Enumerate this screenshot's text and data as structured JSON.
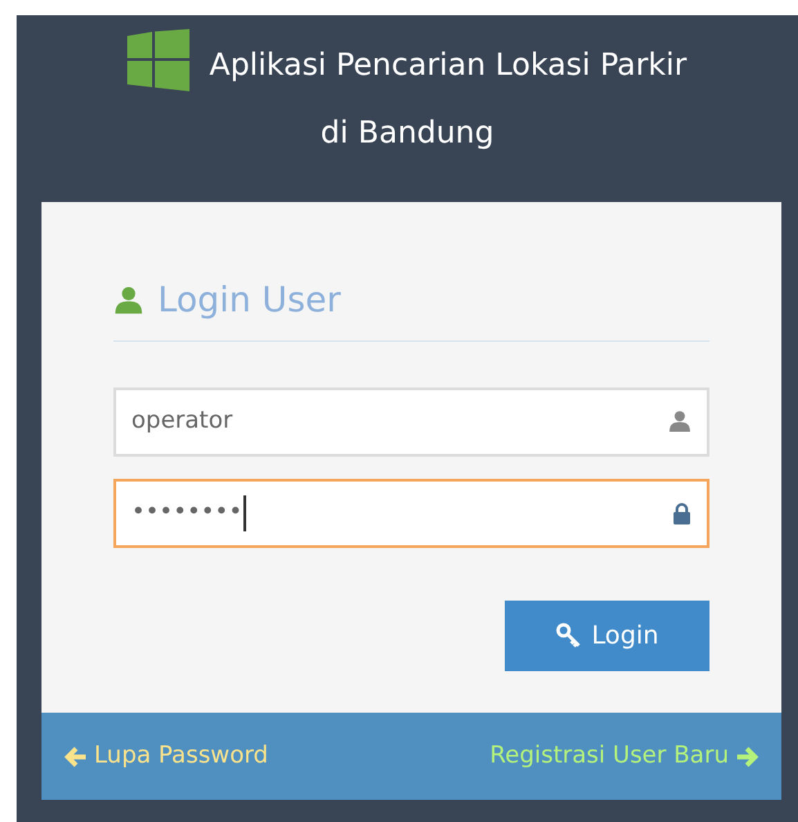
{
  "header": {
    "title_line_1": "Aplikasi Pencarian Lokasi Parkir",
    "title_line_2": "di Bandung"
  },
  "login": {
    "heading": "Login User",
    "fields": [
      {
        "kind": "user",
        "value": "operator",
        "focused": false
      },
      {
        "kind": "lock",
        "value": "••••••••",
        "focused": true
      }
    ],
    "button": "Login"
  },
  "footer": {
    "left_link": "Lupa Password",
    "right_link": "Registrasi User Baru"
  }
}
